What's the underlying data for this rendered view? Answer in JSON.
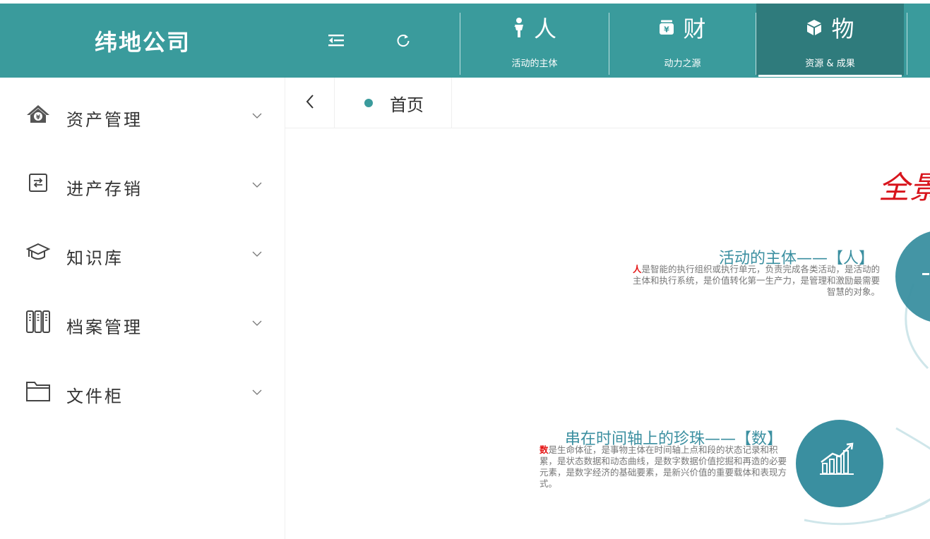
{
  "header": {
    "brand": "纬地公司",
    "tabs": [
      {
        "title": "人",
        "subtitle": "活动的主体",
        "icon": "person-icon"
      },
      {
        "title": "财",
        "subtitle": "动力之源",
        "icon": "money-bag-icon"
      },
      {
        "title": "物",
        "subtitle": "资源 & 成果",
        "icon": "cube-icon",
        "active": true
      }
    ],
    "icons": [
      "menu-fold-icon",
      "refresh-icon"
    ]
  },
  "sidebar": {
    "items": [
      {
        "label": "资产管理",
        "icon": "house-money-icon"
      },
      {
        "label": "进产存销",
        "icon": "exchange-icon"
      },
      {
        "label": "知识库",
        "icon": "graduation-cap-icon"
      },
      {
        "label": "档案管理",
        "icon": "binders-icon"
      },
      {
        "label": "文件柜",
        "icon": "folder-icon"
      }
    ]
  },
  "tabbar": {
    "home_label": "首页",
    "back_icon": "chevron-left-icon"
  },
  "content": {
    "calligraphy": "全景",
    "person_block": {
      "title": "活动的主体——【人】",
      "highlight": "人",
      "text": "是智能的执行组织或执行单元，负责完成各类活动，是活动的主体和执行系统，是价值转化第一生产力，是管理和激励最需要智慧的对象。"
    },
    "data_block": {
      "title": "串在时间轴上的珍珠——【数】",
      "highlight": "数",
      "text": "是生命体征，是事物主体在时间轴上点和段的状态记录和积累，是状态数据和动态曲线，是数字数据价值挖掘和再造的必要元素，是数字经济的基础要素，是新兴价值的重要载体和表现方式。"
    }
  },
  "colors": {
    "primary": "#3a9b9c",
    "active_tab": "#2f7b7c",
    "title_teal": "#3b8fa0",
    "highlight_red": "#e41414"
  }
}
